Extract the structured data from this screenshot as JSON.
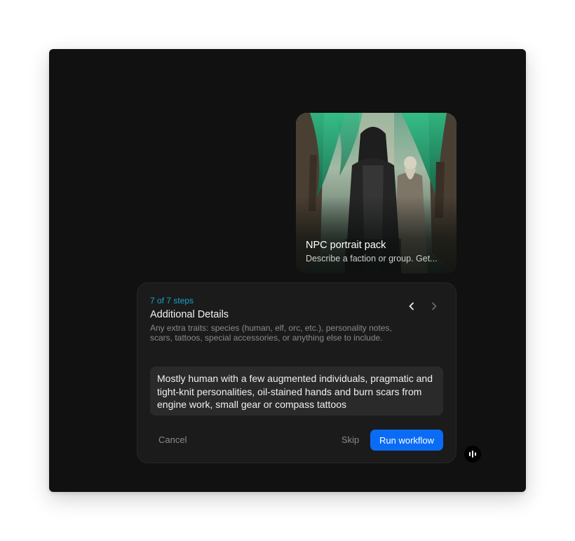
{
  "card": {
    "title": "NPC portrait pack",
    "description": "Describe a faction or group. Get..."
  },
  "wizard": {
    "step_counter": "7 of 7 steps",
    "title": "Additional Details",
    "description": "Any extra traits: species (human, elf, orc, etc.), personality notes, scars, tattoos, special accessories, or anything else to include.",
    "answer": "Mostly human with a few augmented individuals, pragmatic and tight-knit personalities, oil-stained hands and burn scars from engine work, small gear or compass tattoos",
    "prev_icon": "chevron-left-icon",
    "next_icon": "chevron-right-icon"
  },
  "footer": {
    "cancel_label": "Cancel",
    "skip_label": "Skip",
    "run_label": "Run workflow"
  },
  "fab": {
    "icon": "audio-bars-icon"
  },
  "colors": {
    "window_bg": "#111111",
    "panel_bg": "#1b1b1b",
    "accent": "#1ba3c9",
    "primary_button": "#0a6cf5"
  }
}
